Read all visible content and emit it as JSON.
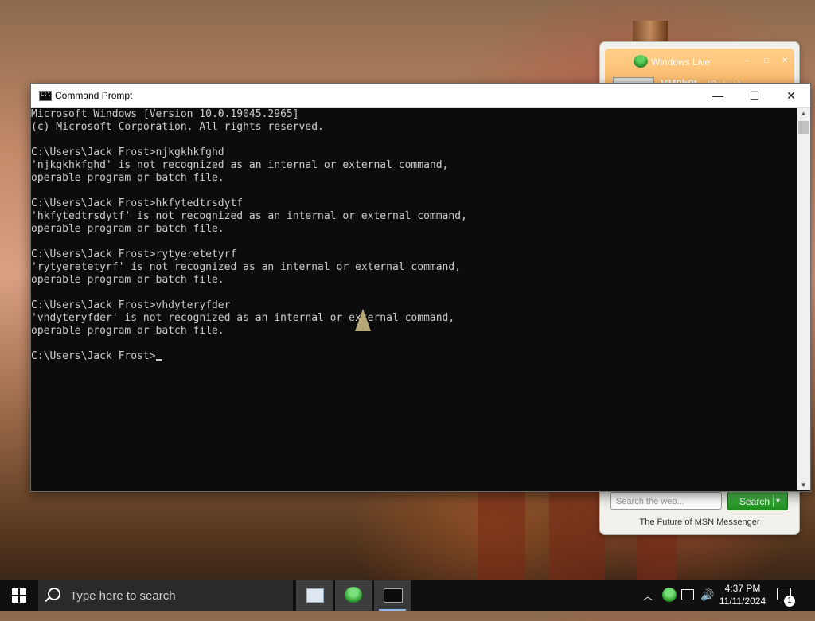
{
  "messenger": {
    "title": "Windows Live",
    "username": "VM0b0t",
    "status": "(Online) ▾",
    "search_placeholder": "Search the web...",
    "search_button": "Search",
    "footer": "The Future of MSN Messenger",
    "accent": "#f9a64a"
  },
  "cmd": {
    "title": "Command Prompt",
    "lines": [
      "Microsoft Windows [Version 10.0.19045.2965]",
      "(c) Microsoft Corporation. All rights reserved.",
      "",
      "C:\\Users\\Jack Frost>njkgkhkfghd",
      "'njkgkhkfghd' is not recognized as an internal or external command,",
      "operable program or batch file.",
      "",
      "C:\\Users\\Jack Frost>hkfytedtrsdytf",
      "'hkfytedtrsdytf' is not recognized as an internal or external command,",
      "operable program or batch file.",
      "",
      "C:\\Users\\Jack Frost>rytyeretetyrf",
      "'rytyeretetyrf' is not recognized as an internal or external command,",
      "operable program or batch file.",
      "",
      "C:\\Users\\Jack Frost>vhdyteryfder",
      "'vhdyteryfder' is not recognized as an internal or external command,",
      "operable program or batch file.",
      ""
    ],
    "prompt": "C:\\Users\\Jack Frost>",
    "minimize_glyph": "—",
    "maximize_glyph": "☐",
    "close_glyph": "✕"
  },
  "taskbar": {
    "search_placeholder": "Type here to search",
    "time": "4:37 PM",
    "date": "11/11/2024",
    "notification_count": "1",
    "apps": [
      "file-explorer-icon",
      "msn-messenger-icon",
      "command-prompt-icon"
    ]
  }
}
